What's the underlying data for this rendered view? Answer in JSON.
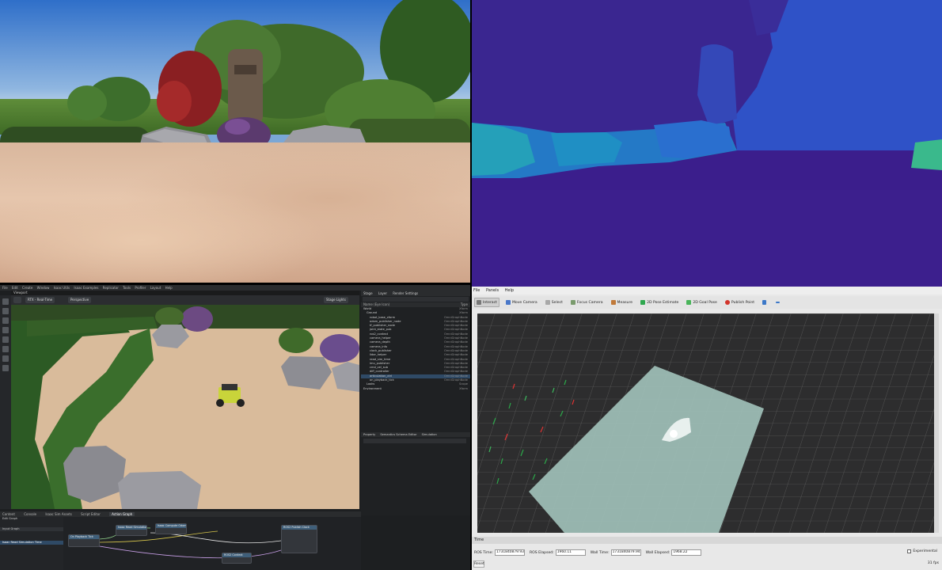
{
  "rgb_view": {},
  "depth_view": {},
  "sim": {
    "menu": [
      "File",
      "Edit",
      "Create",
      "Window",
      "Isaac Utils",
      "Isaac Examples",
      "Replicator",
      "Tools",
      "Profiler",
      "Layout",
      "Help"
    ],
    "viewport_tab": "Viewport",
    "viewport_toolbar": {
      "rtx": "RTX - Real-Time",
      "camera": "Perspective",
      "lights": "Stage Lights"
    },
    "stage_tabs": [
      "Stage",
      "Layer",
      "Render Settings"
    ],
    "stage_header": {
      "name": "Name (Eye Icon)",
      "type": "Type"
    },
    "stage_tree": [
      {
        "name": "World",
        "type": "Xform"
      },
      {
        "name": "Ground",
        "type": "Xform"
      },
      {
        "name": "robot_base_xform",
        "type": "OmniGraphNode"
      },
      {
        "name": "odom_publisher_node",
        "type": "OmniGraphNode"
      },
      {
        "name": "tf_publisher_node",
        "type": "OmniGraphNode"
      },
      {
        "name": "joint_state_pub",
        "type": "OmniGraphNode"
      },
      {
        "name": "ros2_context",
        "type": "OmniGraphNode"
      },
      {
        "name": "camera_helper",
        "type": "OmniGraphNode"
      },
      {
        "name": "camera_depth",
        "type": "OmniGraphNode"
      },
      {
        "name": "camera_info",
        "type": "OmniGraphNode"
      },
      {
        "name": "clock_publisher",
        "type": "OmniGraphNode"
      },
      {
        "name": "lidar_helper",
        "type": "OmniGraphNode"
      },
      {
        "name": "read_sim_time",
        "type": "OmniGraphNode"
      },
      {
        "name": "imu_publisher",
        "type": "OmniGraphNode"
      },
      {
        "name": "cmd_vel_sub",
        "type": "OmniGraphNode"
      },
      {
        "name": "diff_controller",
        "type": "OmniGraphNode"
      },
      {
        "name": "articulation_ctrl",
        "type": "OmniGraphNode"
      },
      {
        "name": "on_playback_tick",
        "type": "OmniGraphNode"
      },
      {
        "name": "Looks",
        "type": "Scope"
      },
      {
        "name": "Environment",
        "type": "Xform"
      }
    ],
    "props_tabs": [
      "Property",
      "Semantics Schema Editor",
      "Simulation"
    ],
    "bottom_tabs": [
      "Content",
      "Console",
      "Isaac Sim Assets",
      "Script Editor",
      "Action Graph"
    ],
    "graph_label": "Edit Graph",
    "graph_sidebar": [
      "Input Graph",
      "Isaac Read Simulation Time"
    ],
    "graph_nodes": [
      "On Playback Tick",
      "Isaac Read Simulation Time",
      "ROS2 Context",
      "ROS2 Publish Clock",
      "Isaac Compute Odometry"
    ]
  },
  "rviz": {
    "menu": [
      "File",
      "Panels",
      "Help"
    ],
    "tools": [
      {
        "label": "Interact",
        "color": "#777777"
      },
      {
        "label": "Move Camera",
        "color": "#4a78c9"
      },
      {
        "label": "Select",
        "color": "#a8a8a8"
      },
      {
        "label": "Focus Camera",
        "color": "#7a9b6d"
      },
      {
        "label": "Measure",
        "color": "#c07a3a"
      },
      {
        "label": "2D Pose Estimate",
        "color": "#2fa84f"
      },
      {
        "label": "2D Goal Pose",
        "color": "#49b45a"
      },
      {
        "label": "Publish Point",
        "color": "#d2352c"
      }
    ],
    "time_panel_title": "Time",
    "ros_time_label": "ROS Time:",
    "ros_time": "1731840879.93",
    "ros_elapsed_label": "ROS Elapsed:",
    "ros_elapsed": "1960.11",
    "wall_time_label": "Wall Time:",
    "wall_time": "1731840879.94",
    "wall_elapsed_label": "Wall Elapsed:",
    "wall_elapsed": "1968.22",
    "experimental_label": "Experimental",
    "reset_label": "Reset",
    "fps": "31 fps"
  }
}
